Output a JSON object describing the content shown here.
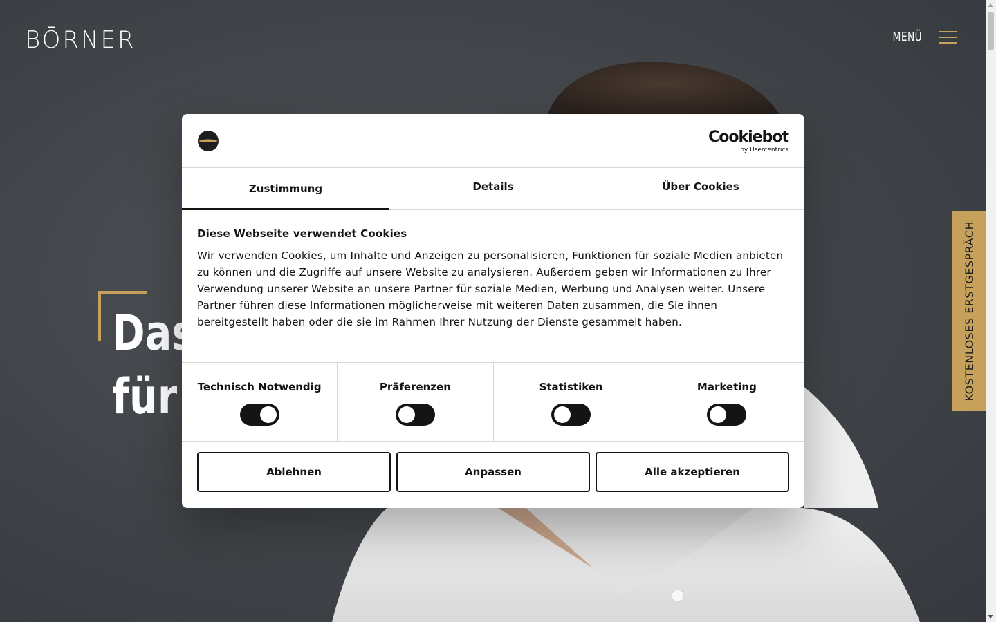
{
  "header": {
    "logo_text": "BŌRNER",
    "menu_label": "MENÜ"
  },
  "hero": {
    "title_line1": "Das",
    "title_line2": "für"
  },
  "side_cta": {
    "label": "KOSTENLOSES ERSTGESPRÄCH"
  },
  "cookie_dialog": {
    "provider": "Cookiebot",
    "provider_sub": "by Usercentrics",
    "tabs": [
      {
        "label": "Zustimmung",
        "active": true
      },
      {
        "label": "Details",
        "active": false
      },
      {
        "label": "Über Cookies",
        "active": false
      }
    ],
    "title": "Diese Webseite verwendet Cookies",
    "text": "Wir verwenden Cookies, um Inhalte und Anzeigen zu personalisieren, Funktionen für soziale Medien anbieten zu können und die Zugriffe auf unsere Website zu analysieren. Außerdem geben wir Informationen zu Ihrer Verwendung unserer Website an unsere Partner für soziale Medien, Werbung und Analysen weiter. Unsere Partner führen diese Informationen möglicherweise mit weiteren Daten zusammen, die Sie ihnen bereitgestellt haben oder die sie im Rahmen Ihrer Nutzung der Dienste gesammelt haben.",
    "categories": [
      {
        "label": "Technisch Notwendig",
        "enabled": true
      },
      {
        "label": "Präferenzen",
        "enabled": false
      },
      {
        "label": "Statistiken",
        "enabled": false
      },
      {
        "label": "Marketing",
        "enabled": false
      }
    ],
    "buttons": {
      "decline": "Ablehnen",
      "customize": "Anpassen",
      "accept_all": "Alle akzeptieren"
    }
  },
  "colors": {
    "accent_gold": "#c6a15b",
    "dialog_text": "#141414",
    "background_dark": "#34383c"
  }
}
